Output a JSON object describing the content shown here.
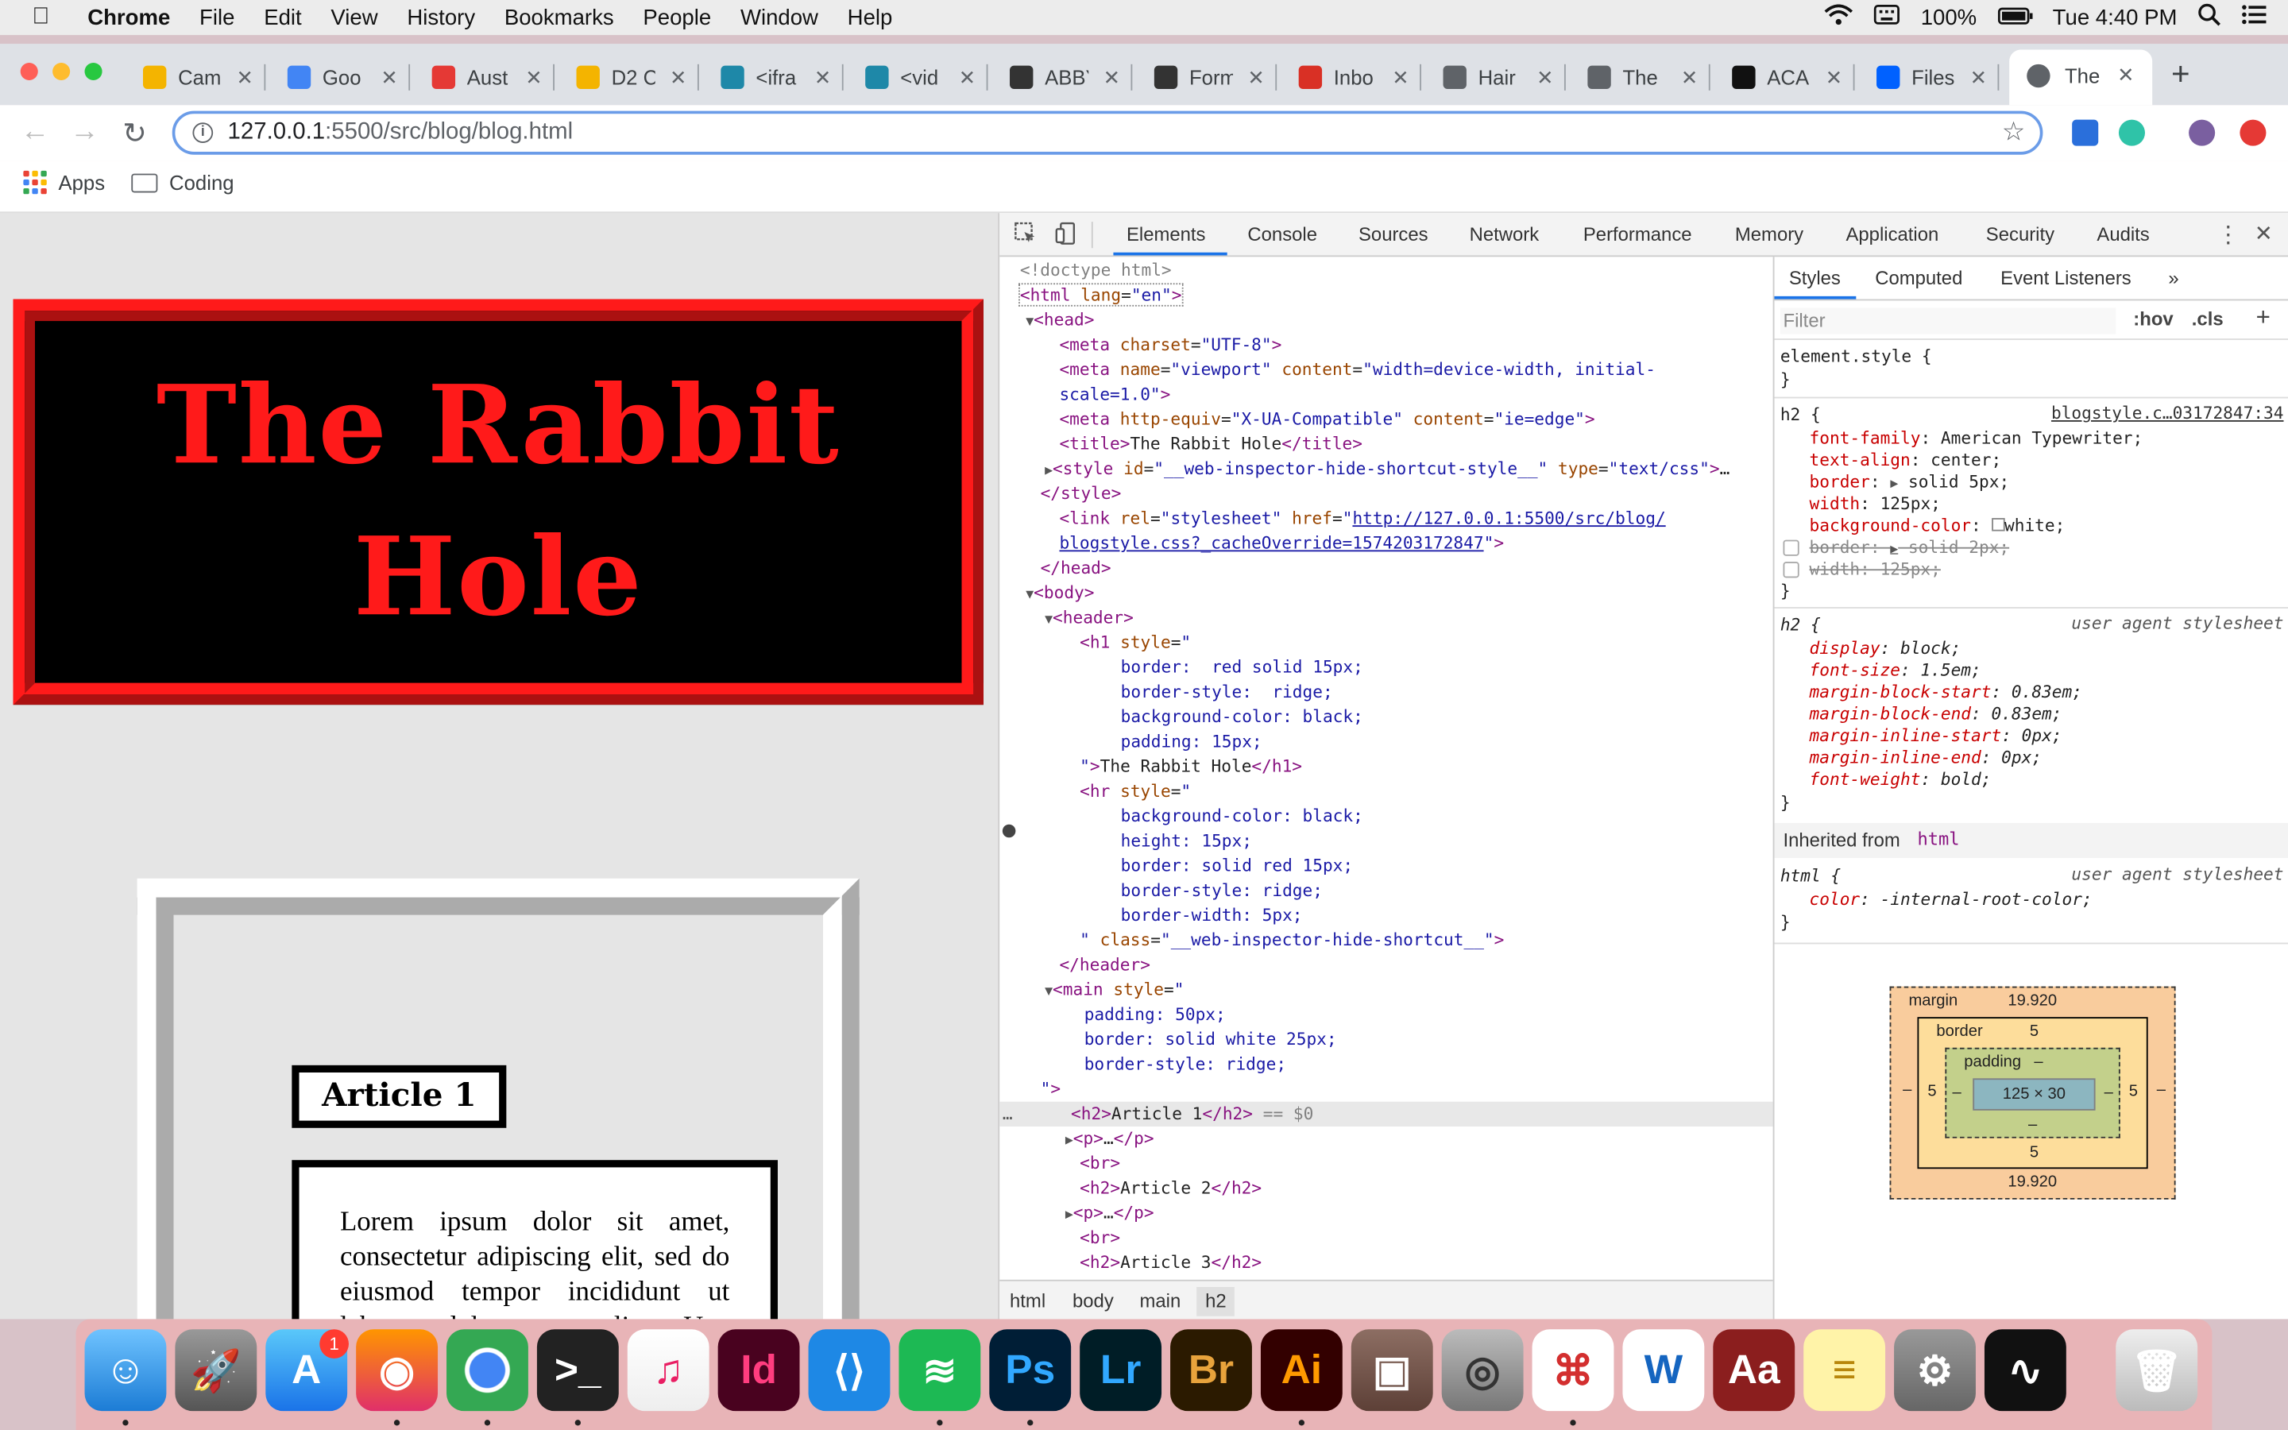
{
  "menubar": {
    "app": "Chrome",
    "items": [
      "File",
      "Edit",
      "View",
      "History",
      "Bookmarks",
      "People",
      "Window",
      "Help"
    ],
    "battery": "100%",
    "clock": "Tue 4:40 PM"
  },
  "tabs": [
    {
      "title": "Cam",
      "color": "#f4b400"
    },
    {
      "title": "Goo",
      "color": "#4285f4"
    },
    {
      "title": "Aust",
      "color": "#e53935"
    },
    {
      "title": "D2 C",
      "color": "#f4b400"
    },
    {
      "title": "<ifra",
      "color": "#1e88a8"
    },
    {
      "title": "<vid",
      "color": "#1e88a8"
    },
    {
      "title": "ABBY",
      "color": "#333333"
    },
    {
      "title": "Form",
      "color": "#333333"
    },
    {
      "title": "Inbo",
      "color": "#d93025"
    },
    {
      "title": "Hair",
      "color": "#5f6368"
    },
    {
      "title": "The",
      "color": "#5f6368"
    },
    {
      "title": "ACA",
      "color": "#111111"
    },
    {
      "title": "Files",
      "color": "#0061ff"
    }
  ],
  "active_tab": {
    "title": "The"
  },
  "address": {
    "host": "127.0.0.1",
    "path": ":5500/src/blog/blog.html"
  },
  "bookmarks": {
    "apps": "Apps",
    "coding": "Coding"
  },
  "page": {
    "h1": "The Rabbit Hole",
    "article_heading": "Article 1",
    "paragraph": "Lorem ipsum dolor sit amet, consectetur adipiscing elit, sed do eiusmod tempor incididunt ut labore et dolore magna aliqua. Ut"
  },
  "devtools": {
    "tabs": [
      "Elements",
      "Console",
      "Sources",
      "Network",
      "Performance",
      "Memory",
      "Application",
      "Security",
      "Audits"
    ],
    "breadcrumbs": [
      "html",
      "body",
      "main",
      "h2"
    ],
    "styles_tabs": [
      "Styles",
      "Computed",
      "Event Listeners"
    ],
    "filter_placeholder": "Filter",
    "hov": ":hov",
    "cls": ".cls",
    "source_link": "blogstyle.c…03172847:34",
    "user_agent": "user agent stylesheet",
    "inherited_label": "Inherited from",
    "inherited_tag": "html",
    "boxmodel": {
      "margin_label": "margin",
      "margin_value": "19.920",
      "margin_bottom": "19.920",
      "border_label": "border",
      "border_value": "5",
      "border_bottom": "5",
      "border_side": "5",
      "padding_label": "padding",
      "padding_value": "–",
      "padding_bottom": "–",
      "margin_side": "–",
      "content": "125 × 30"
    }
  },
  "dock": {
    "apps": [
      "Finder",
      "Launchpad",
      "App Store",
      "Firefox",
      "Chrome",
      "Terminal",
      "iTunes",
      "InDesign",
      "VS Code",
      "Spotify",
      "Photoshop",
      "Lightroom",
      "Bridge",
      "Illustrator",
      "Preview",
      "Image Capture",
      "Acrobat",
      "Word",
      "Dictionary",
      "Notes",
      "System Preferences",
      "Activity Monitor",
      "Trash"
    ],
    "appstore_badge": "1"
  }
}
